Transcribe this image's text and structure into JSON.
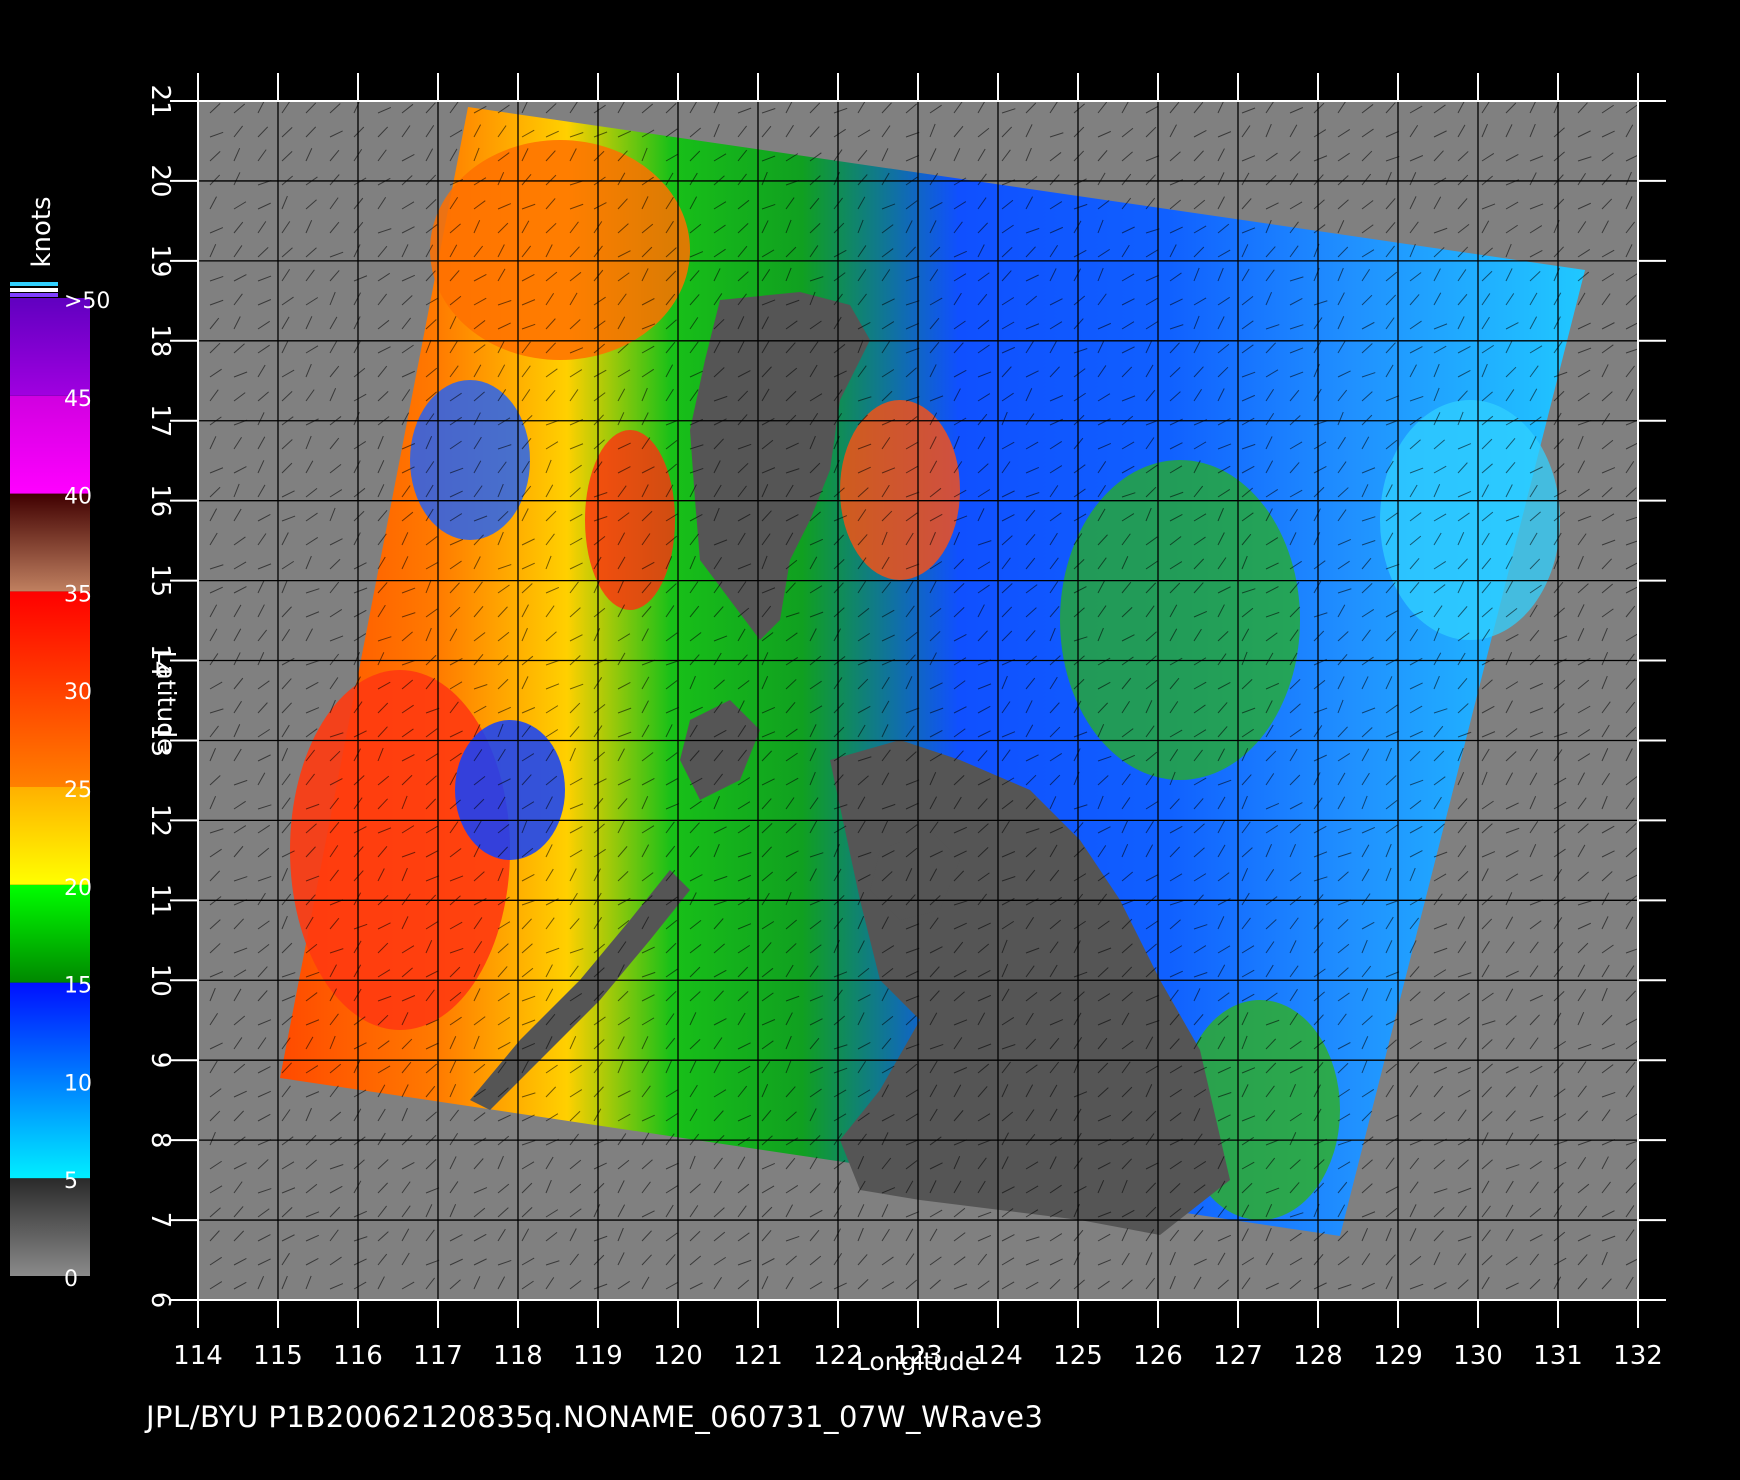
{
  "map": {
    "xlabel": "Longitude",
    "ylabel": "Latitude",
    "lon_range": [
      114,
      132
    ],
    "lat_range": [
      6,
      21
    ],
    "lon_ticks": [
      "114",
      "115",
      "116",
      "117",
      "118",
      "119",
      "120",
      "121",
      "122",
      "123",
      "124",
      "125",
      "126",
      "127",
      "128",
      "129",
      "130",
      "131",
      "132"
    ],
    "lat_ticks": [
      "6",
      "7",
      "8",
      "9",
      "10",
      "11",
      "12",
      "13",
      "14",
      "15",
      "16",
      "17",
      "18",
      "19",
      "20",
      "21"
    ],
    "colors": {
      "background": "#000000",
      "ocean_outside_swath": "#808080",
      "land": "#555555",
      "grid": "#000000"
    }
  },
  "colorbar": {
    "unit": "knots",
    "labels": [
      ">50",
      "45",
      "40",
      "35",
      "30",
      "25",
      "20",
      "15",
      "10",
      "5",
      "0"
    ],
    "bands": [
      {
        "from": 0,
        "to": 5,
        "color_start": "#8a8a8a",
        "color_end": "#2a2a2a"
      },
      {
        "from": 5,
        "to": 15,
        "color_start": "#00eeff",
        "color_end": "#0010ff"
      },
      {
        "from": 15,
        "to": 20,
        "color_start": "#008800",
        "color_end": "#00ff00"
      },
      {
        "from": 20,
        "to": 25,
        "color_start": "#ffff00",
        "color_end": "#ffb000"
      },
      {
        "from": 25,
        "to": 35,
        "color_start": "#ff8000",
        "color_end": "#ff0000"
      },
      {
        "from": 35,
        "to": 40,
        "color_start": "#c08060",
        "color_end": "#400000"
      },
      {
        "from": 40,
        "to": 45,
        "color_start": "#ff00ff",
        "color_end": "#d000e0"
      },
      {
        "from": 45,
        "to": 50,
        "color_start": "#a000e0",
        "color_end": "#6000c0"
      }
    ]
  },
  "footer": {
    "text": "JPL/BYU  P1B20062120835q.NONAME_060731_07W_WRave3"
  }
}
